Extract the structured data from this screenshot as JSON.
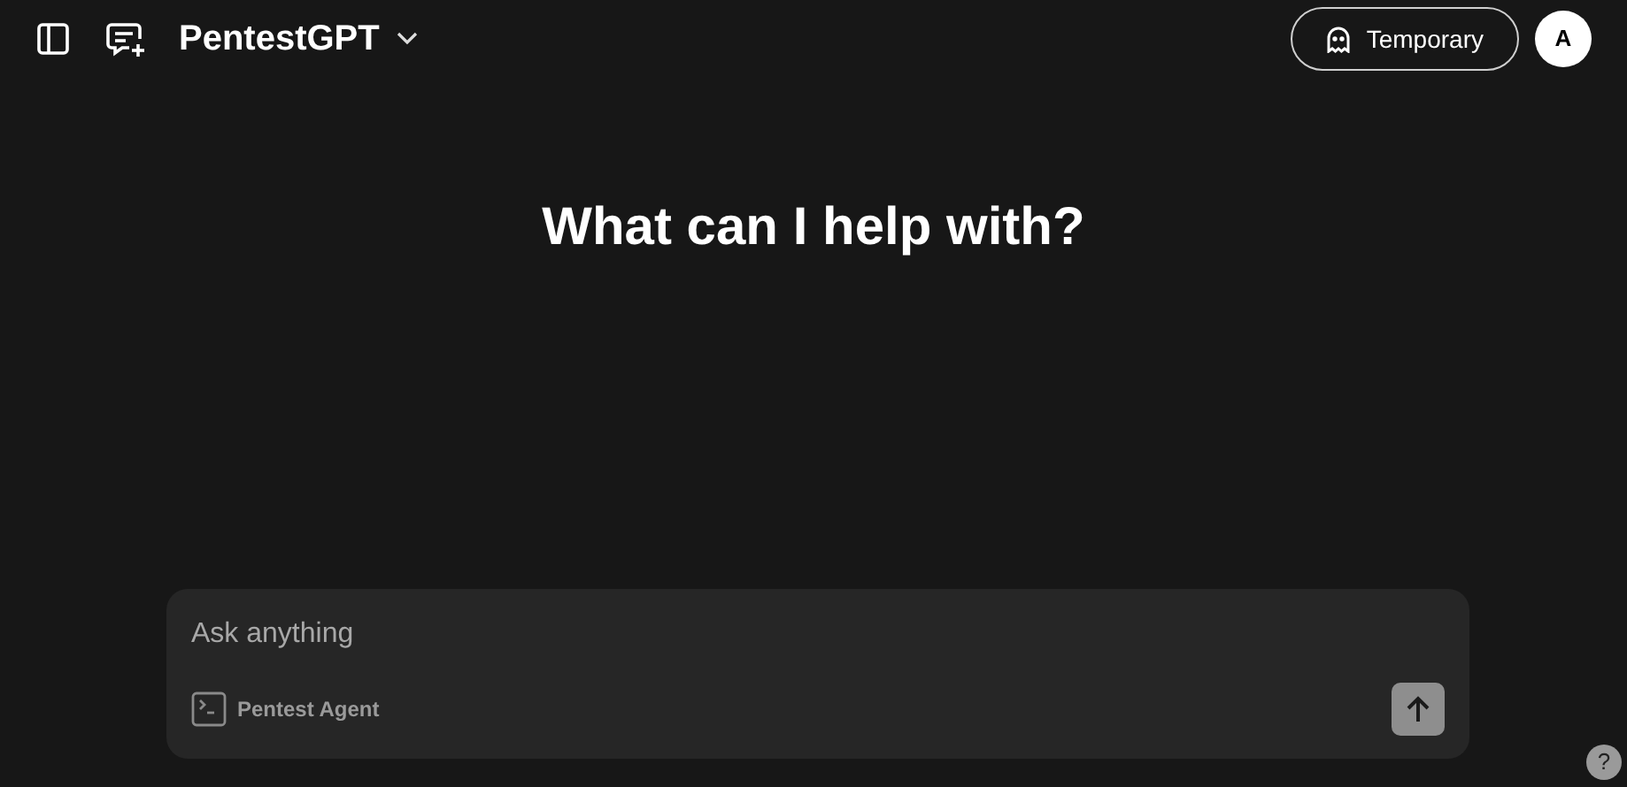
{
  "header": {
    "model_name": "PentestGPT",
    "temporary_button": "Temporary",
    "avatar_initial": "A"
  },
  "heading": "What can I help with?",
  "composer": {
    "placeholder": "Ask anything",
    "agent_label": "Pentest Agent",
    "send_disabled": true
  },
  "help_button": "?"
}
